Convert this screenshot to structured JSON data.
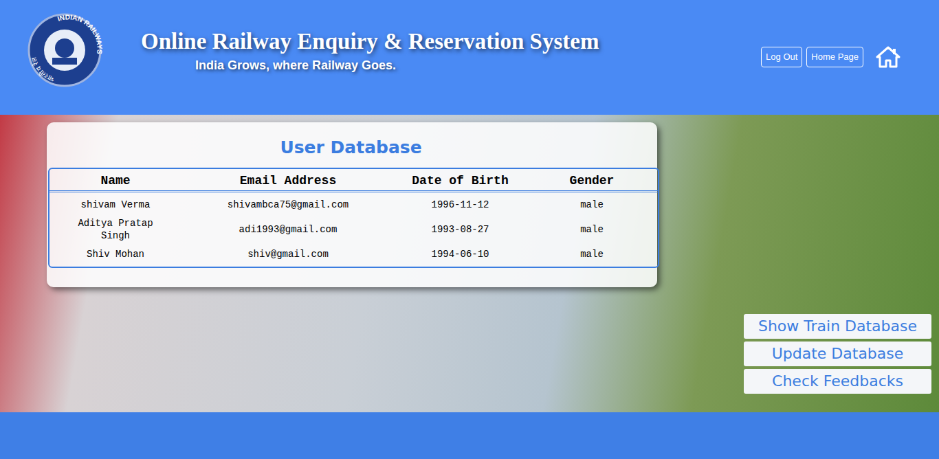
{
  "header": {
    "logo": {
      "text_hi": "भारतीय रेल",
      "text_en": "INDIAN RAILWAYS"
    },
    "title": "Online Railway Enquiry & Reservation System",
    "subtitle": "India Grows, where Railway Goes.",
    "buttons": [
      "Log Out",
      "Home Page"
    ]
  },
  "card": {
    "title": "User Database",
    "table": {
      "columns": [
        "Name",
        "Email Address",
        "Date of Birth",
        "Gender"
      ],
      "rows": [
        [
          "shivam Verma",
          "shivambca75@gmail.com",
          "1996-11-12",
          "male"
        ],
        [
          "Aditya Pratap Singh",
          "adi1993@gmail.com",
          "1993-08-27",
          "male"
        ],
        [
          "Shiv Mohan",
          "shiv@gmail.com",
          "1994-06-10",
          "male"
        ]
      ]
    }
  },
  "side_buttons": [
    "Show Train Database",
    "Update Database",
    "Check Feedbacks"
  ]
}
